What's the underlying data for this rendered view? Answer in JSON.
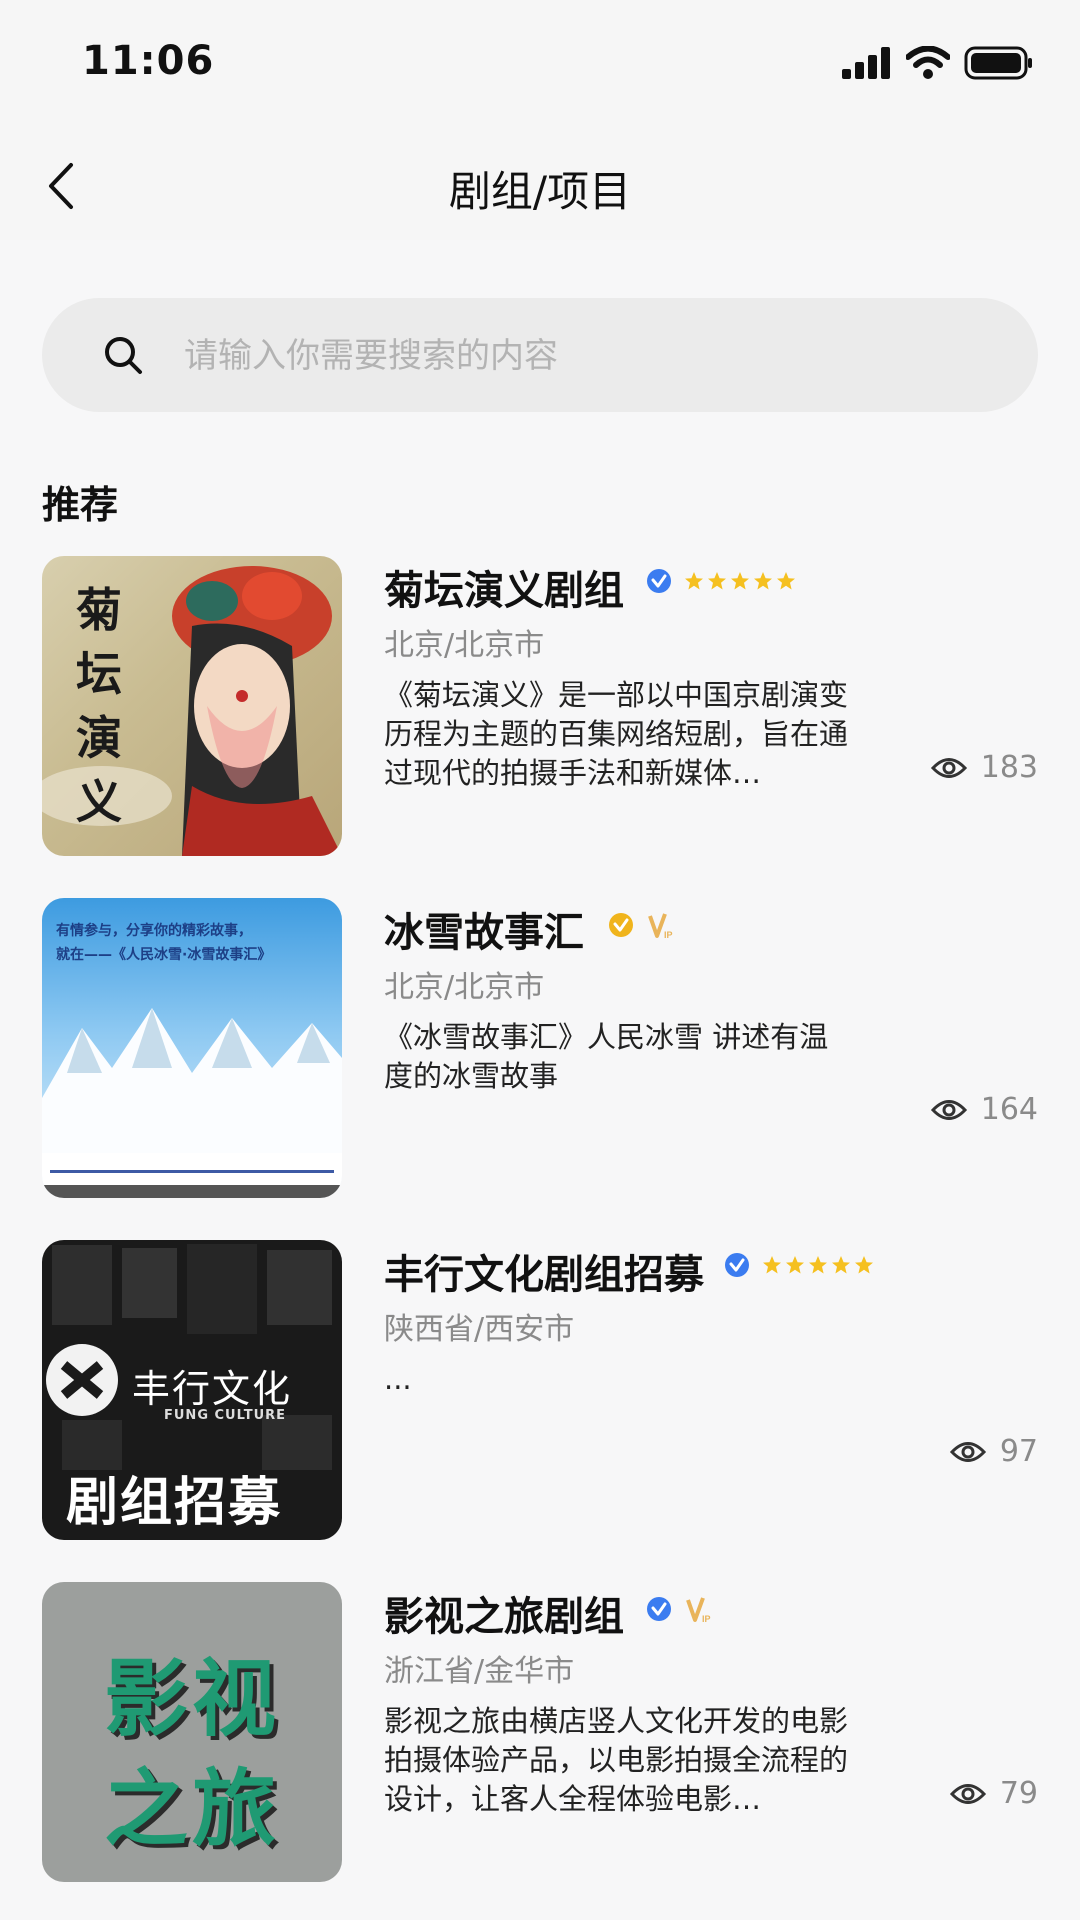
{
  "status_bar": {
    "time": "11:06"
  },
  "nav": {
    "title": "剧组/项目"
  },
  "search": {
    "placeholder": "请输入你需要搜索的内容"
  },
  "section": {
    "title": "推荐"
  },
  "items": [
    {
      "title": "菊坛演义剧组",
      "verified": "blue",
      "rating_stars": 5,
      "vip": false,
      "location": "北京/北京市",
      "description": "《菊坛演义》是一部以中国京剧演变历程为主题的百集网络短剧，旨在通过现代的拍摄手法和新媒体…",
      "views": "183",
      "thumb_text": [
        "菊",
        "坛",
        "演",
        "义"
      ]
    },
    {
      "title": "冰雪故事汇",
      "verified": "gold",
      "rating_stars": 0,
      "vip": true,
      "location": "北京/北京市",
      "description": "《冰雪故事汇》人民冰雪 讲述有温度的冰雪故事",
      "views": "164",
      "thumb_text": [
        "有情参与，分享你的精彩故事，",
        "就在——《人民冰雪·冰雪故事汇》"
      ]
    },
    {
      "title": "丰行文化剧组招募",
      "verified": "blue",
      "rating_stars": 5,
      "vip": false,
      "location": "陕西省/西安市",
      "description": "...",
      "views": "97",
      "thumb_text": [
        "丰行文化",
        "FUNG CULTURE",
        "剧组招募"
      ]
    },
    {
      "title": "影视之旅剧组",
      "verified": "blue",
      "rating_stars": 0,
      "vip": true,
      "location": "浙江省/金华市",
      "description": "影视之旅由横店竖人文化开发的电影拍摄体验产品，以电影拍摄全流程的设计，让客人全程体验电影…",
      "views": "79",
      "thumb_text": [
        "影视",
        "之旅"
      ]
    }
  ],
  "colors": {
    "verified_blue": "#3b7cf0",
    "verified_gold": "#f0b41c",
    "star": "#f5c020",
    "vip": "#e9b45a"
  }
}
